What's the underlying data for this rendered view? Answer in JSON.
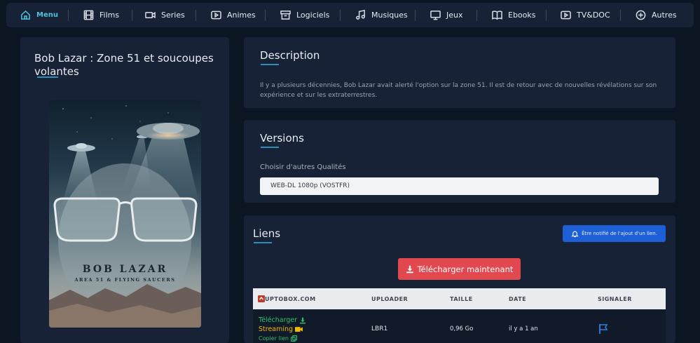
{
  "nav": {
    "items": [
      {
        "label": "Menu",
        "icon": "home-icon"
      },
      {
        "label": "Films",
        "icon": "film-icon"
      },
      {
        "label": "Series",
        "icon": "video-camera-icon"
      },
      {
        "label": "Animes",
        "icon": "play-icon"
      },
      {
        "label": "Logiciels",
        "icon": "archive-icon"
      },
      {
        "label": "Musiques",
        "icon": "music-icon"
      },
      {
        "label": "Jeux",
        "icon": "monitor-icon"
      },
      {
        "label": "Ebooks",
        "icon": "book-icon"
      },
      {
        "label": "TV&DOC",
        "icon": "tv-icon"
      },
      {
        "label": "Autres",
        "icon": "plus-circle-icon"
      }
    ]
  },
  "movie": {
    "title": "Bob Lazar : Zone 51 et soucoupes volantes",
    "poster_title": "BOB LAZAR",
    "poster_subtitle": "AREA 51 & FLYING SAUCERS"
  },
  "description": {
    "title": "Description",
    "text": "Il y a plusieurs décennies, Bob Lazar avait alerté l'option sur la zone 51. Il est de retour avec de nouvelles révélations sur son expérience et sur les extraterrestres."
  },
  "versions": {
    "title": "Versions",
    "label": "Choisir d'autres Qualités",
    "selected": "WEB-DL 1080p (VOSTFR)"
  },
  "links": {
    "title": "Liens",
    "notify_label": "Être notifié de l'ajout d'un lien.",
    "download_label": "Télécharger maintenant",
    "columns": [
      "UPTOBOX.COM",
      "UPLOADER",
      "TAILLE",
      "DATE",
      "SIGNALER"
    ],
    "rows": [
      {
        "download": "Télécharger",
        "streaming": "Streaming",
        "copy": "Copier lien",
        "uploader": "LBR1",
        "size": "0,96 Go",
        "date": "il y a 1 an"
      }
    ]
  },
  "colors": {
    "accent": "#4ec2e0",
    "download_button": "#e2494f",
    "notify_button": "#1d5fd6",
    "link_green": "#2fbf6a",
    "link_orange": "#f2b705"
  }
}
